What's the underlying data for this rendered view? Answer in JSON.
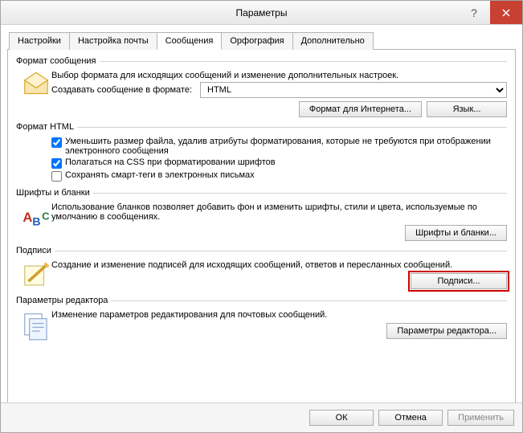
{
  "window": {
    "title": "Параметры"
  },
  "tabs": {
    "settings": "Настройки",
    "mail_setup": "Настройка почты",
    "messages": "Сообщения",
    "spelling": "Орфография",
    "advanced": "Дополнительно"
  },
  "message_format": {
    "legend": "Формат сообщения",
    "desc": "Выбор формата для исходящих сообщений и изменение дополнительных настроек.",
    "create_label": "Создавать сообщение в формате:",
    "format_value": "HTML",
    "internet_format_btn": "Формат для Интернета...",
    "language_btn": "Язык..."
  },
  "html_format": {
    "legend": "Формат HTML",
    "reduce_size": "Уменьшить размер файла, удалив атрибуты форматирования, которые не требуются при отображении электронного сообщения",
    "rely_css": "Полагаться на CSS при форматировании шрифтов",
    "save_smart": "Сохранять смарт-теги в электронных письмах"
  },
  "fonts_blanks": {
    "legend": "Шрифты и бланки",
    "desc": "Использование бланков позволяет добавить фон и изменить шрифты, стили и цвета, используемые по умолчанию в сообщениях.",
    "btn": "Шрифты и бланки..."
  },
  "signatures": {
    "legend": "Подписи",
    "desc": "Создание и изменение подписей для исходящих сообщений, ответов и пересланных сообщений.",
    "btn": "Подписи..."
  },
  "editor": {
    "legend": "Параметры редактора",
    "desc": "Изменение параметров редактирования для почтовых сообщений.",
    "btn": "Параметры редактора..."
  },
  "footer": {
    "ok": "ОК",
    "cancel": "Отмена",
    "apply": "Применить"
  }
}
